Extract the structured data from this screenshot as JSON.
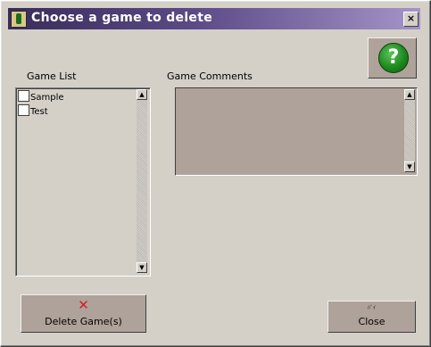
{
  "window": {
    "title": "Choose a game to delete",
    "close_glyph": "×"
  },
  "help": {
    "glyph": "?"
  },
  "game_list": {
    "label": "Game List",
    "items": [
      {
        "name": "Sample",
        "checked": false
      },
      {
        "name": "Test",
        "checked": false
      }
    ]
  },
  "comments": {
    "label": "Game Comments",
    "value": ""
  },
  "buttons": {
    "delete": {
      "label": "Delete Game(s)",
      "icon_glyph": "✕"
    },
    "close": {
      "label": "Close",
      "icon_glyph": "ﾊﾞｲ"
    }
  },
  "icons": {
    "app": "game-app-icon",
    "help": "question-mark-icon",
    "delete": "red-x-icon",
    "close": "close-small-icon"
  },
  "colors": {
    "titlebar_start": "#3a2c5a",
    "titlebar_end": "#a494c8",
    "panel": "#d4d0c8",
    "button_face": "#aea29a",
    "help_green": "#1e8a1e",
    "delete_red": "#d21e1e"
  }
}
